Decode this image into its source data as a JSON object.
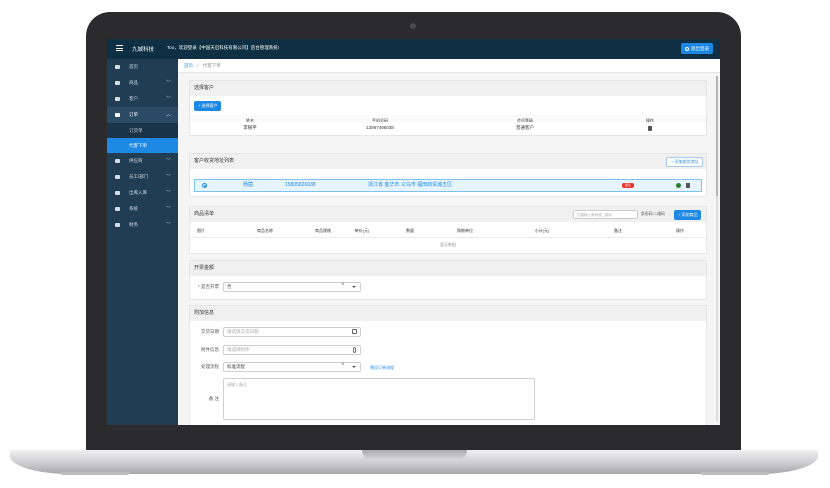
{
  "app": {
    "brand": "九城科技",
    "welcome": "Too，欢迎登录【中国天启科技有限公司】后台管理系统!",
    "logout_label": "退出登录"
  },
  "sidebar": {
    "items": [
      {
        "label": "首页",
        "icon": "home-icon",
        "chevron": ""
      },
      {
        "label": "商品",
        "icon": "goods-icon",
        "chevron": "﹀"
      },
      {
        "label": "客户",
        "icon": "user-icon",
        "chevron": "﹀"
      },
      {
        "label": "订单",
        "icon": "order-icon",
        "chevron": "︿"
      },
      {
        "label": "供应商",
        "icon": "supplier-icon",
        "chevron": "﹀"
      },
      {
        "label": "员工/部门",
        "icon": "staff-icon",
        "chevron": "﹀"
      },
      {
        "label": "出库入库",
        "icon": "warehouse-icon",
        "chevron": "﹀"
      },
      {
        "label": "系统",
        "icon": "gear-icon",
        "chevron": "﹀"
      },
      {
        "label": "财务",
        "icon": "finance-icon",
        "chevron": "﹀"
      }
    ],
    "order_sub": [
      "订货单",
      "代客下单"
    ]
  },
  "breadcrumb": {
    "home": "首页",
    "sep": "/",
    "current": "代客下单"
  },
  "customer": {
    "title": "选择客户",
    "add_button": "+ 选择客户",
    "columns": [
      "姓名",
      "手机号码",
      "会员等级",
      "操作"
    ],
    "row": {
      "name": "李银平",
      "phone": "13967406038",
      "level": "普通客户"
    }
  },
  "address": {
    "title": "客户收货地址列表",
    "add_button": "+ 添加收货地址",
    "row": {
      "name": "杨茵",
      "phone": "15805826938",
      "address": "浙江省 金华市 义乌市 福田商贸城五区",
      "tag": "默认"
    }
  },
  "goods": {
    "title": "商品清单",
    "search_placeholder": "扫描输入条码或二维码",
    "search_label": "条形码/二维码",
    "add_button": "+ 添加商品",
    "columns": [
      "图片",
      "商品名称",
      "商品规格",
      "单价(元)",
      "数量",
      "购物单位",
      "小计(元)",
      "备注",
      "操作"
    ],
    "empty": "暂无数据"
  },
  "invoice": {
    "title": "开票金额",
    "label": "* 是否开票",
    "value": "否"
  },
  "extra": {
    "title": "附加信息",
    "date_label": "交货日期",
    "date_placeholder": "请选择交货日期",
    "attach_label": "附件信息",
    "attach_placeholder": "请选择附件",
    "flow_label": "处理流程",
    "flow_value": "标准流程",
    "flow_link": "预设订单流程",
    "note_label": "备 注",
    "note_placeholder": "请输入备注"
  },
  "colors": {
    "topbar": "#0f2f44",
    "sidebar": "#213d54",
    "accent": "#1e88e5",
    "danger": "#e53935"
  }
}
